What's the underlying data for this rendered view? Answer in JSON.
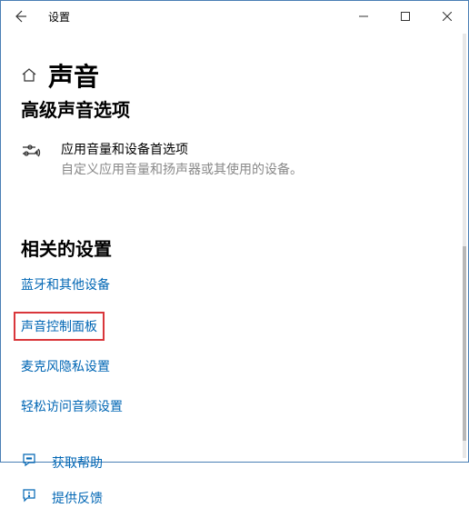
{
  "titlebar": {
    "app_name": "设置"
  },
  "page": {
    "title": "声音",
    "section_cut": "高级声音选项"
  },
  "app_volume": {
    "title": "应用音量和设备首选项",
    "subtitle": "自定义应用音量和扬声器或其使用的设备。"
  },
  "related": {
    "heading": "相关的设置",
    "links": [
      "蓝牙和其他设备",
      "声音控制面板",
      "麦克风隐私设置",
      "轻松访问音频设置"
    ]
  },
  "footer": {
    "help": "获取帮助",
    "feedback": "提供反馈"
  }
}
